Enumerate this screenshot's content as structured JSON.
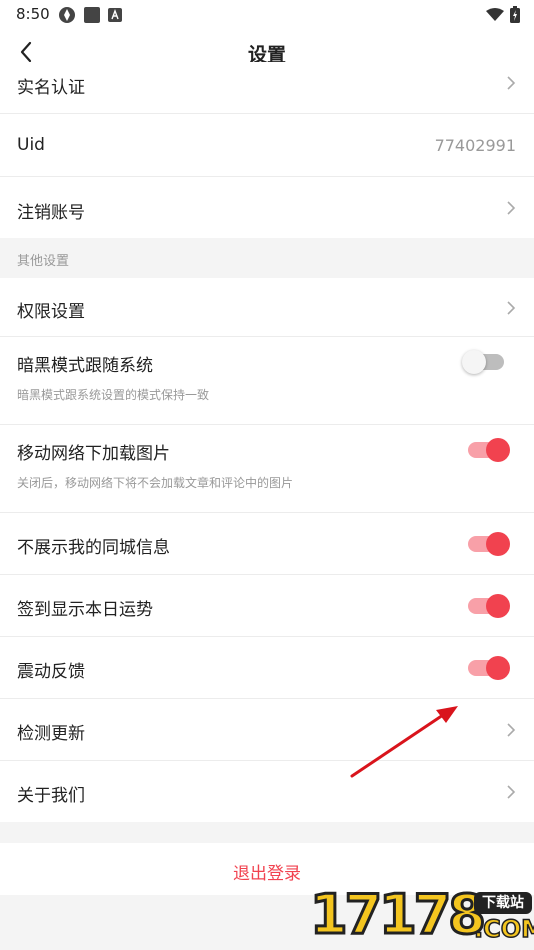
{
  "status_bar": {
    "time": "8:50",
    "icons_left": [
      "settings-icon",
      "square-icon",
      "a-icon"
    ],
    "icons_right": [
      "wifi-icon",
      "battery-charging-icon"
    ]
  },
  "header": {
    "title": "设置",
    "back_icon": "chevron-left-icon"
  },
  "account_group": [
    {
      "label": "实名认证",
      "type": "link"
    },
    {
      "label": "Uid",
      "value": "77402991",
      "type": "value"
    },
    {
      "label": "注销账号",
      "type": "link"
    }
  ],
  "other_section": {
    "header": "其他设置",
    "items": [
      {
        "label": "权限设置",
        "type": "link"
      },
      {
        "label": "暗黑模式跟随系统",
        "sub": "暗黑模式跟系统设置的模式保持一致",
        "type": "toggle",
        "on": false
      },
      {
        "label": "移动网络下加载图片",
        "sub": "关闭后，移动网络下将不会加载文章和评论中的图片",
        "type": "toggle",
        "on": true
      },
      {
        "label": "不展示我的同城信息",
        "type": "toggle",
        "on": true
      },
      {
        "label": "签到显示本日运势",
        "type": "toggle",
        "on": true
      },
      {
        "label": "震动反馈",
        "type": "toggle",
        "on": true
      },
      {
        "label": "检测更新",
        "type": "link"
      },
      {
        "label": "关于我们",
        "type": "link"
      }
    ]
  },
  "logout_label": "退出登录",
  "watermark": {
    "digits": "17178",
    "badge": "下载站",
    "suffix": ".COM"
  },
  "colors": {
    "accent": "#f1424f",
    "toggle_track_on": "#f8a0a8",
    "muted_text": "#999999",
    "annotation_arrow": "#d9141c"
  }
}
